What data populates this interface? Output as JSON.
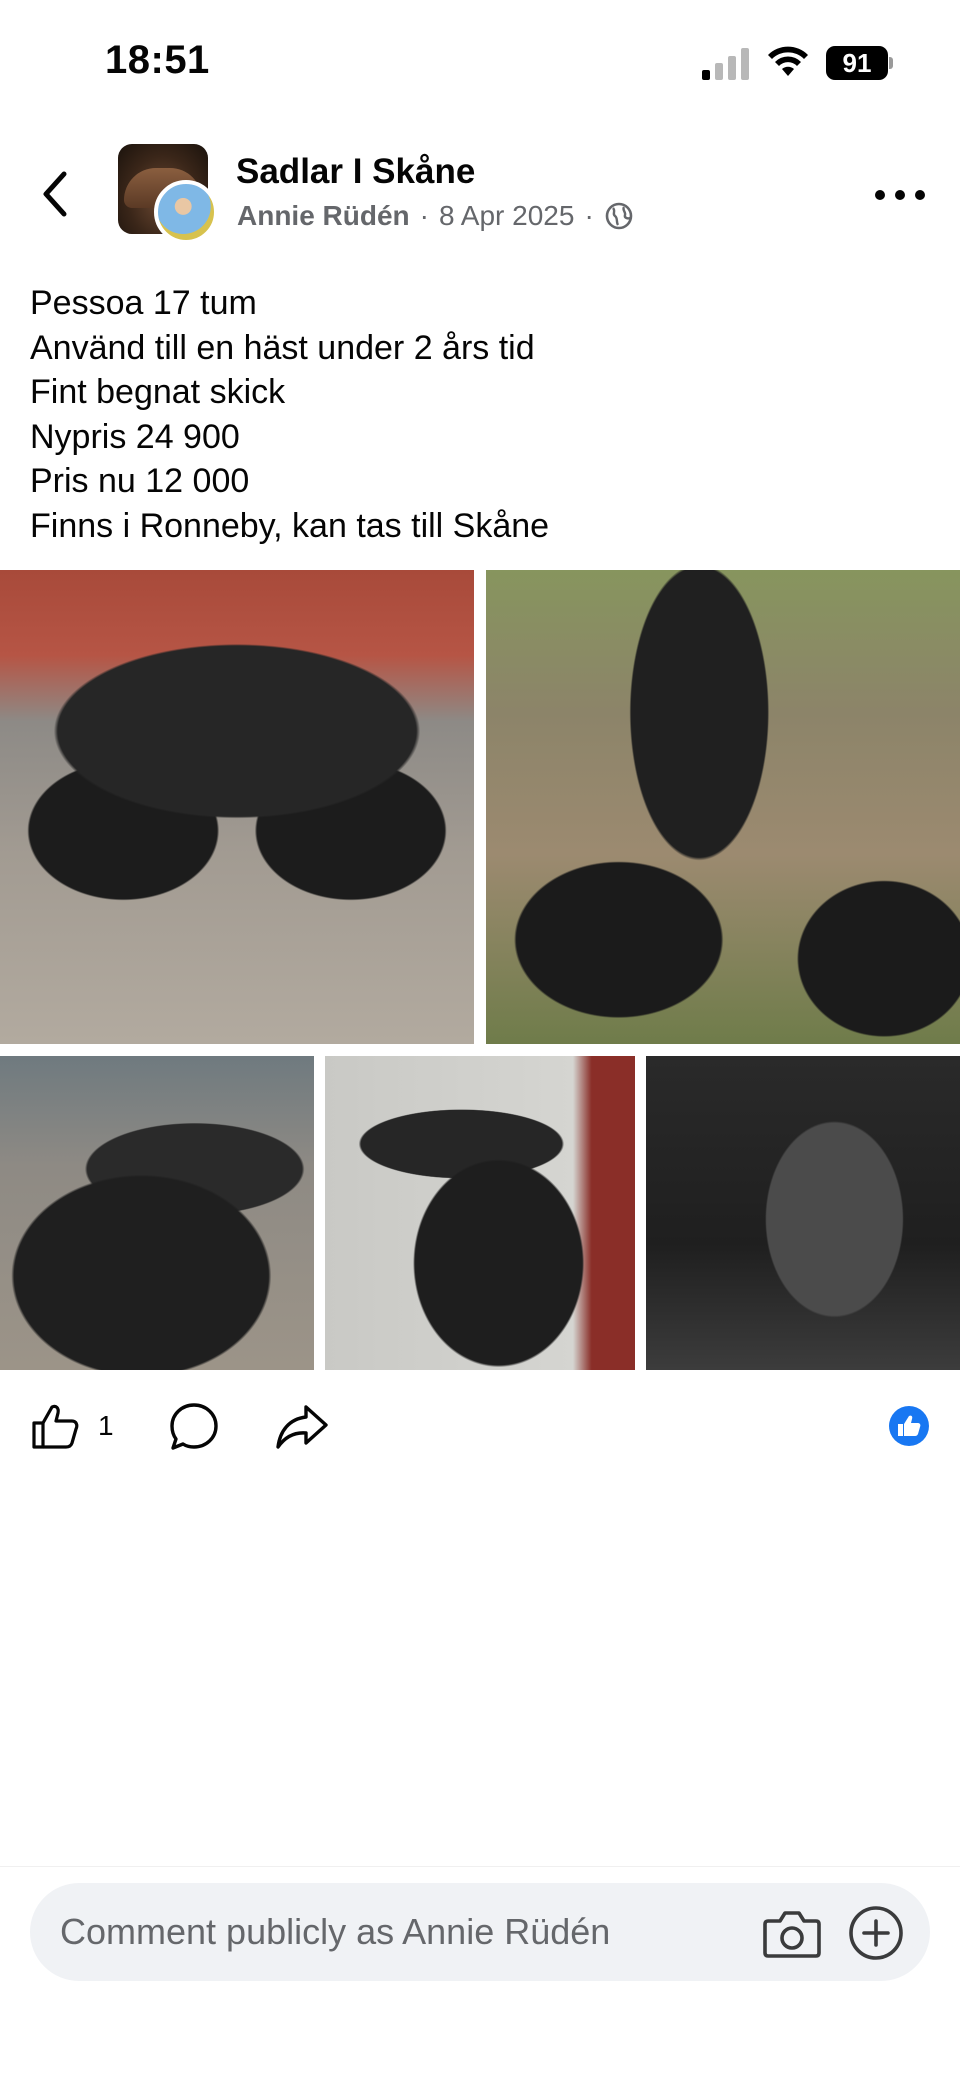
{
  "status_bar": {
    "time": "18:51",
    "battery": "91",
    "icons": [
      "cellular-signal-icon",
      "wifi-icon",
      "battery-icon"
    ]
  },
  "header": {
    "group_name": "Sadlar I Skåne",
    "author": "Annie Rüdén",
    "separator": "·",
    "date": "8 Apr 2025",
    "privacy_icon": "globe-icon",
    "icons": [
      "back-arrow-icon",
      "more-options-icon"
    ]
  },
  "post": {
    "lines": [
      "Pessoa 17 tum",
      "Använd till en häst under 2 års tid",
      "Fint begnat skick",
      "Nypris 24 900",
      "Pris nu 12 000",
      "Finns i Ronneby, kan tas till Skåne"
    ]
  },
  "actions": {
    "like_count": "1",
    "icons": [
      "like-icon",
      "comment-icon",
      "share-icon",
      "like-reaction-icon"
    ],
    "reaction_color": "#1877f2"
  },
  "comment_bar": {
    "placeholder": "Comment publicly as Annie Rüdén",
    "icons": [
      "camera-icon",
      "add-icon"
    ]
  }
}
